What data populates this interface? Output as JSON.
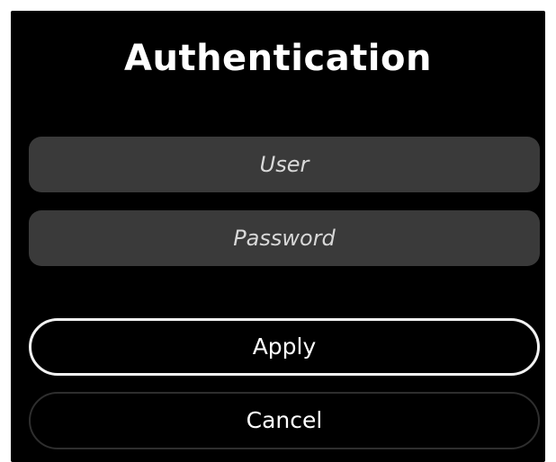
{
  "dialog": {
    "title": "Authentication",
    "user_field": {
      "placeholder": "User",
      "value": ""
    },
    "password_field": {
      "placeholder": "Password",
      "value": ""
    },
    "apply_label": "Apply",
    "cancel_label": "Cancel"
  },
  "colors": {
    "background": "#000000",
    "field_background": "#3a3a3a",
    "text": "#ffffff",
    "apply_border": "#f2f2f2",
    "cancel_border": "#2e2e2e"
  }
}
